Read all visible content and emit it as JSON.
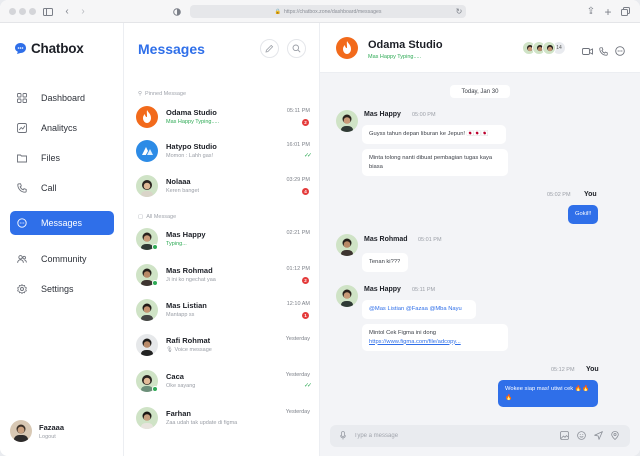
{
  "browser": {
    "url": "https://chatbox.zone/dashboard/messages"
  },
  "sidebar": {
    "brand": "Chatbox",
    "items": [
      {
        "label": "Dashboard",
        "icon": "grid-icon"
      },
      {
        "label": "Analitycs",
        "icon": "chart-icon"
      },
      {
        "label": "Files",
        "icon": "folder-icon"
      },
      {
        "label": "Call",
        "icon": "phone-icon"
      },
      {
        "label": "Messages",
        "icon": "chat-icon"
      },
      {
        "label": "Community",
        "icon": "users-icon"
      },
      {
        "label": "Settings",
        "icon": "gear-icon"
      }
    ],
    "user": {
      "name": "Fazaaa",
      "sub": "Logout"
    }
  },
  "list": {
    "title": "Messages",
    "pinned_label": "Pinned Message",
    "all_label": "All Message",
    "pinned": [
      {
        "name": "Odama Studio",
        "preview": "Mas Happy Typing.....",
        "time": "05:11 PM",
        "badge": "2",
        "typing": true
      },
      {
        "name": "Hatypo Studio",
        "preview": "Momon : Lahh gas!",
        "time": "16:01 PM",
        "check": "✓✓"
      },
      {
        "name": "Nolaaa",
        "preview": "Keren banget",
        "time": "03:29 PM",
        "badge": "4"
      }
    ],
    "all": [
      {
        "name": "Mas Happy",
        "preview": "Typing...",
        "time": "02:21 PM",
        "typing": true
      },
      {
        "name": "Mas Rohmad",
        "preview": "Ji ini ko ngechat yaa",
        "time": "01:12 PM",
        "badge": "2"
      },
      {
        "name": "Mas Listian",
        "preview": "Mantapp ss",
        "time": "12:10 AM",
        "badge": "1"
      },
      {
        "name": "Rafi Rohmat",
        "preview": "Voice message",
        "time": "Yesterday"
      },
      {
        "name": "Caca",
        "preview": "Oke sayang",
        "time": "Yesterday",
        "check": "✓✓"
      },
      {
        "name": "Farhan",
        "preview": "Zaa udah tak update di figma",
        "time": "Yesterday"
      }
    ]
  },
  "chat": {
    "title": "Odama Studio",
    "subtitle": "Mas Happy Typing.....",
    "member_count": "14",
    "date": "Today, Jan 30",
    "msg1": {
      "sender": "Mas Happy",
      "time": "05:00 PM",
      "text1": "Guyss tahun depan liburan ke Jepun! 🇯🇵🇯🇵🇯🇵",
      "text2": "Minta tolong nanti dibuat pembagian tugas kaya biasa"
    },
    "me1": {
      "sender": "You",
      "time": "05:02 PM",
      "text": "Gokil!!"
    },
    "msg2": {
      "sender": "Mas Rohmad",
      "time": "05:01 PM",
      "text": "Tenan ki???"
    },
    "msg3": {
      "sender": "Mas Happy",
      "time": "05:11 PM",
      "mention1": "@Mas Listian",
      "mention2": "@Fazaa",
      "mention3": "@Mba Nayu",
      "text": "Mintol Cek Figma ini dong",
      "link": "https://www.figma.com/file/adcopy..."
    },
    "me2": {
      "sender": "You",
      "time": "05:12 PM",
      "text": "Wokee siap mas! utiwi cek 🔥🔥🔥"
    },
    "composer_placeholder": "Type a message"
  },
  "colors": {
    "accent": "#2f6fe9",
    "online": "#2eaa55",
    "badge": "#e43b3b",
    "brand_orange": "#f26a1b"
  }
}
